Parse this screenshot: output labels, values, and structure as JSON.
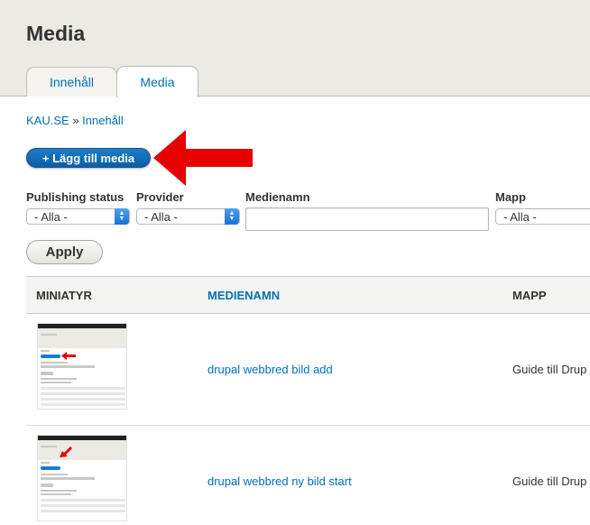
{
  "page": {
    "title": "Media"
  },
  "tabs": [
    {
      "label": "Innehåll",
      "active": false
    },
    {
      "label": "Media",
      "active": true
    }
  ],
  "breadcrumb": {
    "home": "KAU.SE",
    "separator": "»",
    "current": "Innehåll"
  },
  "actions": {
    "add_media_label": "+ Lägg till media"
  },
  "filters": {
    "publishing_status": {
      "label": "Publishing status",
      "value": "- Alla -"
    },
    "provider": {
      "label": "Provider",
      "value": "- Alla -"
    },
    "medianame": {
      "label": "Medienamn",
      "value": ""
    },
    "folder": {
      "label": "Mapp",
      "value": "- Alla -"
    },
    "apply_label": "Apply"
  },
  "table": {
    "columns": [
      "MINIATYR",
      "MEDIENAMN",
      "MAPP"
    ],
    "rows": [
      {
        "name": "drupal webbred bild add",
        "folder": "Guide till Drup"
      },
      {
        "name": "drupal webbred ny bild start",
        "folder": "Guide till Drup"
      }
    ]
  },
  "colors": {
    "link": "#0071b8",
    "primary_button": "#0a5fa6",
    "annotation_arrow": "#e60000",
    "header_bg": "#ebeae4"
  },
  "icons": [
    "red-arrow-icon",
    "select-spinner-icon"
  ]
}
